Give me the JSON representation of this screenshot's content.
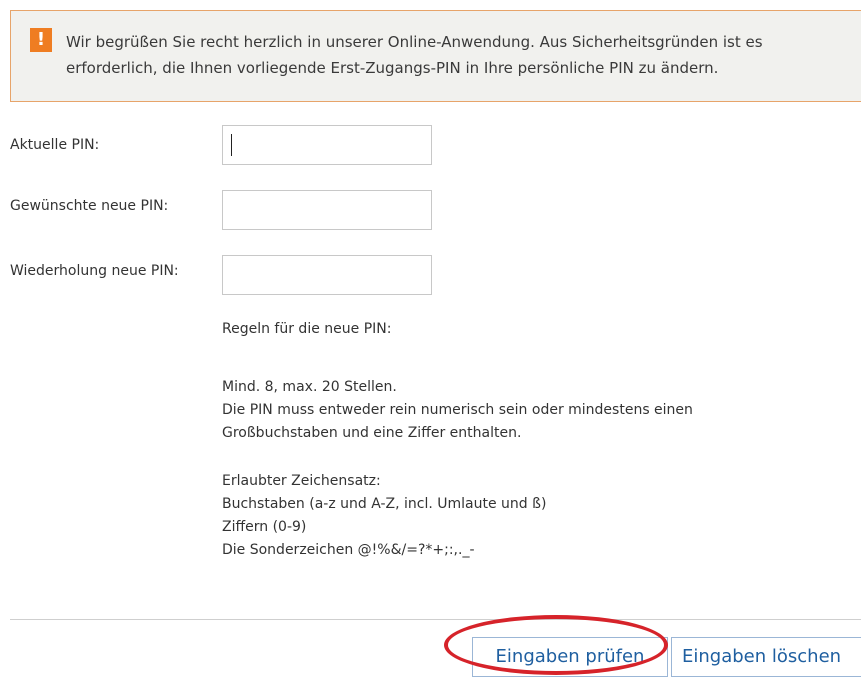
{
  "notice": {
    "icon": "warning-icon",
    "icon_glyph": "!",
    "line1": "Wir begrüßen Sie recht herzlich in unserer Online-Anwendung. Aus Sicherheitsgründen ist es",
    "line2": "erforderlich, die Ihnen vorliegende Erst-Zugangs-PIN in Ihre persönliche PIN zu ändern.",
    "accent_color": "#ef7d22"
  },
  "form": {
    "current_pin_label": "Aktuelle PIN:",
    "current_pin_value": "",
    "new_pin_label": "Gewünschte neue PIN:",
    "new_pin_value": "",
    "repeat_pin_label": "Wiederholung neue PIN:",
    "repeat_pin_value": ""
  },
  "rules": {
    "heading": "Regeln für die neue PIN:",
    "length": "Mind. 8, max. 20 Stellen.",
    "composition_line1": "Die PIN muss entweder rein numerisch sein oder mindestens einen",
    "composition_line2": "Großbuchstaben und eine Ziffer enthalten.",
    "charset_heading": "Erlaubter Zeichensatz:",
    "charset_letters": "Buchstaben (a-z und A-Z, incl. Umlaute und ß)",
    "charset_digits": "Ziffern (0-9)",
    "charset_special": "Die Sonderzeichen @!%&/=?*+;:,._-"
  },
  "actions": {
    "check_label": "Eingaben prüfen",
    "clear_label": "Eingaben löschen",
    "link_color": "#1f5fa0",
    "highlight_color": "#d6232a"
  }
}
